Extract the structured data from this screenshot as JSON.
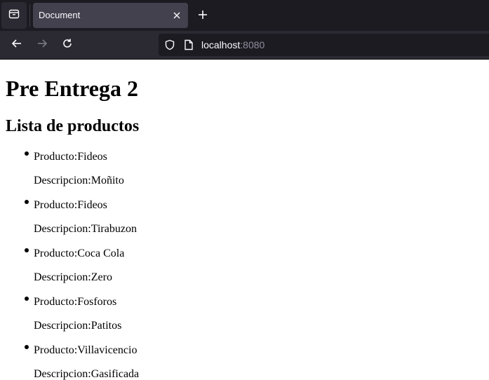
{
  "browser": {
    "tab_title": "Document",
    "url_host": "localhost",
    "url_port": ":8080"
  },
  "page": {
    "title": "Pre Entrega 2",
    "list_title": "Lista de productos",
    "products": [
      {
        "producto": "Producto:Fideos",
        "descripcion": "Descripcion:Moñito"
      },
      {
        "producto": "Producto:Fideos",
        "descripcion": "Descripcion:Tirabuzon"
      },
      {
        "producto": "Producto:Coca Cola",
        "descripcion": "Descripcion:Zero"
      },
      {
        "producto": "Producto:Fosforos",
        "descripcion": "Descripcion:Patitos"
      },
      {
        "producto": "Producto:Villavicencio",
        "descripcion": "Descripcion:Gasificada"
      }
    ]
  },
  "colors": {
    "tabstrip_bg": "#1c1b22",
    "toolbar_bg": "#2b2a33",
    "active_tab_bg": "#42414d",
    "text_light": "#fbfbfe"
  }
}
